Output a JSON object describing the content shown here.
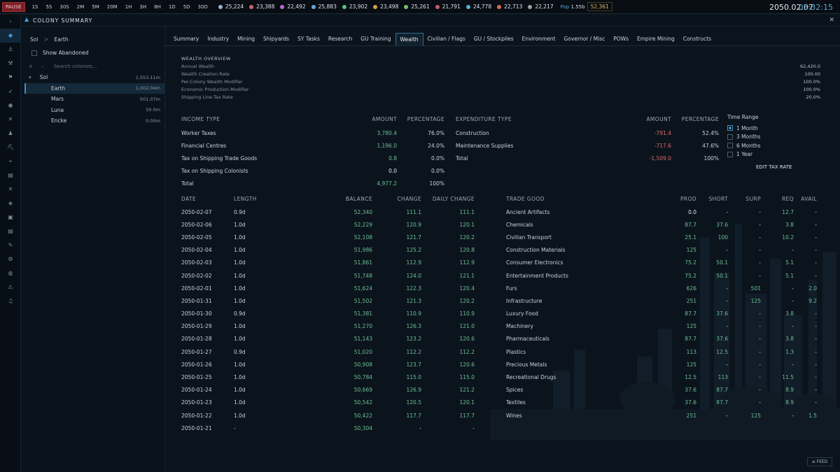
{
  "topbar": {
    "pause": "PAUSE",
    "time_steps": [
      "1S",
      "5S",
      "30S",
      "2M",
      "5M",
      "20M",
      "1H",
      "3H",
      "8H",
      "1D",
      "5D",
      "30D"
    ],
    "resources": [
      {
        "value": "25,224",
        "color": "#9fb3c8"
      },
      {
        "value": "23,388",
        "color": "#c86a6a"
      },
      {
        "value": "22,492",
        "color": "#b26ad0"
      },
      {
        "value": "25,883",
        "color": "#6aa2d8"
      },
      {
        "value": "23,902",
        "color": "#5bbf8a"
      },
      {
        "value": "23,498",
        "color": "#d0a050"
      },
      {
        "value": "25,261",
        "color": "#7ac06a"
      },
      {
        "value": "21,791",
        "color": "#c85a6a"
      },
      {
        "value": "24,778",
        "color": "#5ab0d0"
      },
      {
        "value": "22,713",
        "color": "#d07050"
      },
      {
        "value": "22,217",
        "color": "#a0a0a0"
      }
    ],
    "pop_label": "Pop",
    "pop_value": "1.55b",
    "wealth_value": "52,361",
    "date": "2050.02.07",
    "time": "03:32:15"
  },
  "left_rail_icons": [
    "expand-icon",
    "fleet-icon",
    "anchor-icon",
    "hammer-icon",
    "flag-icon",
    "rocket-icon",
    "target-icon",
    "crossed-swords-icon",
    "person-icon",
    "pickaxe-icon",
    "telescope-icon",
    "clipboard-icon",
    "close-icon",
    "tag-icon",
    "box-icon",
    "document-icon",
    "wrench-icon",
    "gear-icon",
    "globe-icon",
    "warning-icon",
    "music-icon"
  ],
  "window": {
    "title": "COLONY SUMMARY"
  },
  "sidebar": {
    "breadcrumb_root": "Sol",
    "breadcrumb_sep": ">",
    "breadcrumb_current": "Earth",
    "show_abandoned": "Show Abandoned",
    "add": "+",
    "remove": "–",
    "search_placeholder": "Search colonies...",
    "tree": [
      {
        "name": "Sol",
        "pop": "1,553.11m",
        "caret": "▾"
      },
      {
        "name": "Earth",
        "pop": "1,002.04m"
      },
      {
        "name": "Mars",
        "pop": "501.07m"
      },
      {
        "name": "Luna",
        "pop": "50.0m"
      },
      {
        "name": "Encke",
        "pop": "0.00m"
      }
    ]
  },
  "tabs": [
    "Summary",
    "Industry",
    "Mining",
    "Shipyards",
    "SY Tasks",
    "Research",
    "GU Training",
    "Wealth",
    "Civilian / Flags",
    "GU / Stockpiles",
    "Environment",
    "Governor / Misc",
    "POWs",
    "Empire Mining",
    "Constructs"
  ],
  "overview": {
    "header": "WEALTH OVERVIEW",
    "rows": [
      {
        "label": "Annual Wealth",
        "value": "62,420.0"
      },
      {
        "label": "Wealth Creation Rate",
        "value": "100.00"
      },
      {
        "label": "Per-Colony Wealth Modifier",
        "value": "100.0%"
      },
      {
        "label": "Economic Production Modifier",
        "value": "100.0%"
      },
      {
        "label": "Shipping Line Tax Rate",
        "value": "20.0%"
      }
    ]
  },
  "income": {
    "headers": [
      "INCOME TYPE",
      "AMOUNT",
      "PERCENTAGE"
    ],
    "rows": [
      {
        "type": "Worker Taxes",
        "amount": "3,780.4",
        "pct": "76.0%",
        "c": "g"
      },
      {
        "type": "Financial Centres",
        "amount": "1,196.0",
        "pct": "24.0%",
        "c": "g"
      },
      {
        "type": "Tax on Shipping Trade Goods",
        "amount": "0.8",
        "pct": "0.0%",
        "c": "g"
      },
      {
        "type": "Tax on Shipping Colonists",
        "amount": "0.0",
        "pct": "0.0%",
        "c": "w"
      },
      {
        "type": "Total",
        "amount": "4,977.2",
        "pct": "100%",
        "c": "g"
      }
    ]
  },
  "expenditure": {
    "headers": [
      "EXPENDITURE TYPE",
      "AMOUNT",
      "PERCENTAGE"
    ],
    "rows": [
      {
        "type": "Construction",
        "amount": "-791.4",
        "pct": "52.4%"
      },
      {
        "type": "Maintenance Supplies",
        "amount": "-717.6",
        "pct": "47.6%"
      },
      {
        "type": "Total",
        "amount": "-1,509.0",
        "pct": "100%"
      }
    ]
  },
  "time_range": {
    "label": "Time Range",
    "options": [
      "1 Month",
      "3 Months",
      "6 Months",
      "1 Year"
    ],
    "selected": 0,
    "edit_tax": "EDIT TAX RATE"
  },
  "history": {
    "headers": [
      "DATE",
      "LENGTH",
      "BALANCE",
      "CHANGE",
      "DAILY CHANGE"
    ],
    "rows": [
      [
        "2050-02-07",
        "0.9d",
        "52,340",
        "111.1",
        "111.1"
      ],
      [
        "2050-02-06",
        "1.0d",
        "52,229",
        "120.9",
        "120.1"
      ],
      [
        "2050-02-05",
        "1.0d",
        "52,108",
        "121.7",
        "120.2"
      ],
      [
        "2050-02-04",
        "1.0d",
        "51,986",
        "125.2",
        "120.8"
      ],
      [
        "2050-02-03",
        "1.0d",
        "51,861",
        "112.9",
        "112.9"
      ],
      [
        "2050-02-02",
        "1.0d",
        "51,748",
        "124.0",
        "121.1"
      ],
      [
        "2050-02-01",
        "1.0d",
        "51,624",
        "122.3",
        "120.4"
      ],
      [
        "2050-01-31",
        "1.0d",
        "51,502",
        "121.3",
        "120.2"
      ],
      [
        "2050-01-30",
        "0.9d",
        "51,381",
        "110.9",
        "110.9"
      ],
      [
        "2050-01-29",
        "1.0d",
        "51,270",
        "126.3",
        "121.0"
      ],
      [
        "2050-01-28",
        "1.0d",
        "51,143",
        "123.2",
        "120.6"
      ],
      [
        "2050-01-27",
        "0.9d",
        "51,020",
        "112.2",
        "112.2"
      ],
      [
        "2050-01-26",
        "1.0d",
        "50,908",
        "123.7",
        "120.6"
      ],
      [
        "2050-01-25",
        "1.0d",
        "50,784",
        "115.0",
        "115.0"
      ],
      [
        "2050-01-24",
        "1.0d",
        "50,669",
        "126.9",
        "121.2"
      ],
      [
        "2050-01-23",
        "1.0d",
        "50,542",
        "120.5",
        "120.1"
      ],
      [
        "2050-01-22",
        "1.0d",
        "50,422",
        "117.7",
        "117.7"
      ],
      [
        "2050-01-21",
        "-",
        "50,304",
        "-",
        "-"
      ]
    ]
  },
  "trade": {
    "headers": [
      "TRADE GOOD",
      "PROD",
      "SHORT",
      "SURP",
      "REQ",
      "AVAIL"
    ],
    "rows": [
      [
        "Ancient Artifacts",
        "0.0",
        "-",
        "-",
        "12.7",
        "-"
      ],
      [
        "Chemicals",
        "87.7",
        "37.6",
        "-",
        "3.8",
        "-"
      ],
      [
        "Civilian Transport",
        "25.1",
        "100",
        "-",
        "10.2",
        "-"
      ],
      [
        "Construction Materials",
        "125",
        "-",
        "-",
        "-",
        "-"
      ],
      [
        "Consumer Electronics",
        "75.2",
        "50.1",
        "-",
        "5.1",
        "-"
      ],
      [
        "Entertainment Products",
        "75.2",
        "50.1",
        "-",
        "5.1",
        "-"
      ],
      [
        "Furs",
        "626",
        "-",
        "501",
        "-",
        "2.0"
      ],
      [
        "Infrastructure",
        "251",
        "-",
        "125",
        "-",
        "9.2"
      ],
      [
        "Luxury Food",
        "87.7",
        "37.6",
        "-",
        "3.8",
        "-"
      ],
      [
        "Machinery",
        "125",
        "-",
        "-",
        "-",
        "-"
      ],
      [
        "Pharmaceuticals",
        "87.7",
        "37.6",
        "-",
        "3.8",
        "-"
      ],
      [
        "Plastics",
        "113",
        "12.5",
        "-",
        "1.3",
        "-"
      ],
      [
        "Precious Metals",
        "125",
        "-",
        "-",
        "-",
        "-"
      ],
      [
        "Recreational Drugs",
        "12.5",
        "113",
        "-",
        "11.5",
        "-"
      ],
      [
        "Spices",
        "37.6",
        "87.7",
        "-",
        "8.9",
        "-"
      ],
      [
        "Textiles",
        "37.6",
        "87.7",
        "-",
        "8.9",
        "-"
      ],
      [
        "Wines",
        "251",
        "-",
        "125",
        "-",
        "1.5"
      ]
    ]
  },
  "feed": "≡ FEED"
}
